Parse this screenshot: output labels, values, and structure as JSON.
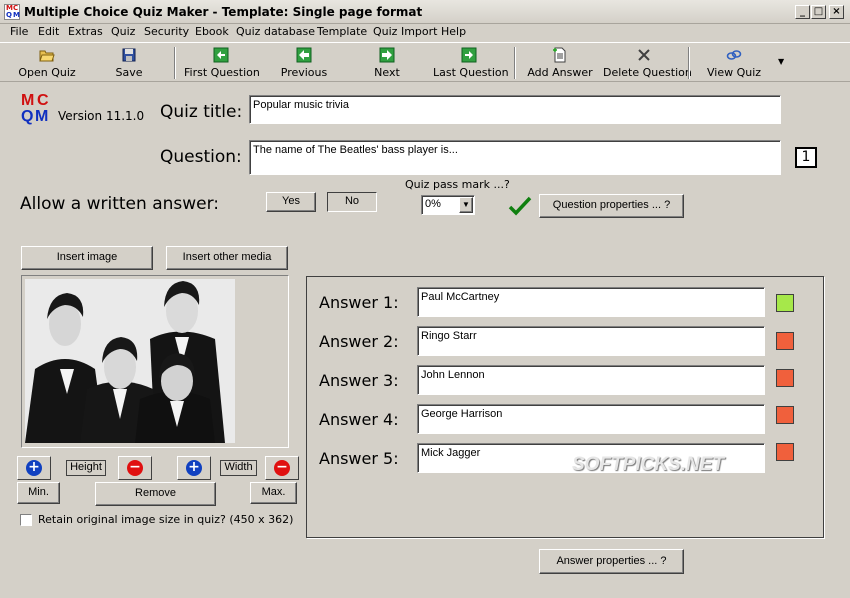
{
  "window": {
    "title": "Multiple Choice Quiz Maker - Template: Single page format"
  },
  "menu": [
    "File",
    "Edit",
    "Extras",
    "Quiz",
    "Security",
    "Ebook",
    "Quiz database",
    "Template",
    "Quiz Import",
    "Help"
  ],
  "toolbar": {
    "open_quiz": "Open Quiz",
    "save": "Save",
    "first_question": "First Question",
    "previous": "Previous",
    "next": "Next",
    "last_question": "Last Question",
    "add_answer": "Add Answer",
    "delete_question": "Delete Question",
    "view_quiz": "View Quiz"
  },
  "logo": {
    "letters": [
      "M",
      "C",
      "Q",
      "M"
    ],
    "version": "Version 11.1.0"
  },
  "quiz": {
    "title_label": "Quiz title:",
    "title_value": "Popular music trivia",
    "question_label": "Question:",
    "question_value": "The name of The Beatles' bass player is...",
    "question_number": "1",
    "written_answer_label": "Allow a written answer:",
    "yes_label": "Yes",
    "no_label": "No",
    "pass_mark_label": "Quiz pass mark ...?",
    "pass_mark_value": "0%",
    "question_properties": "Question properties ... ?"
  },
  "media": {
    "insert_image": "Insert image",
    "insert_other": "Insert other media",
    "height_label": "Height",
    "width_label": "Width",
    "min_label": "Min.",
    "remove_label": "Remove",
    "max_label": "Max.",
    "retain_label": "Retain original image size in quiz? (450 x 362)"
  },
  "answers": [
    {
      "label": "Answer 1:",
      "value": "Paul McCartney",
      "correct": true,
      "color": "#a6e84a"
    },
    {
      "label": "Answer 2:",
      "value": "Ringo Starr",
      "correct": false,
      "color": "#f0603c"
    },
    {
      "label": "Answer 3:",
      "value": "John Lennon",
      "correct": false,
      "color": "#f0603c"
    },
    {
      "label": "Answer 4:",
      "value": "George Harrison",
      "correct": false,
      "color": "#f0603c"
    },
    {
      "label": "Answer 5:",
      "value": "Mick Jagger",
      "correct": false,
      "color": "#f0603c"
    }
  ],
  "answer_properties": "Answer properties ... ?",
  "watermark": "SOFTPICKS.NET"
}
